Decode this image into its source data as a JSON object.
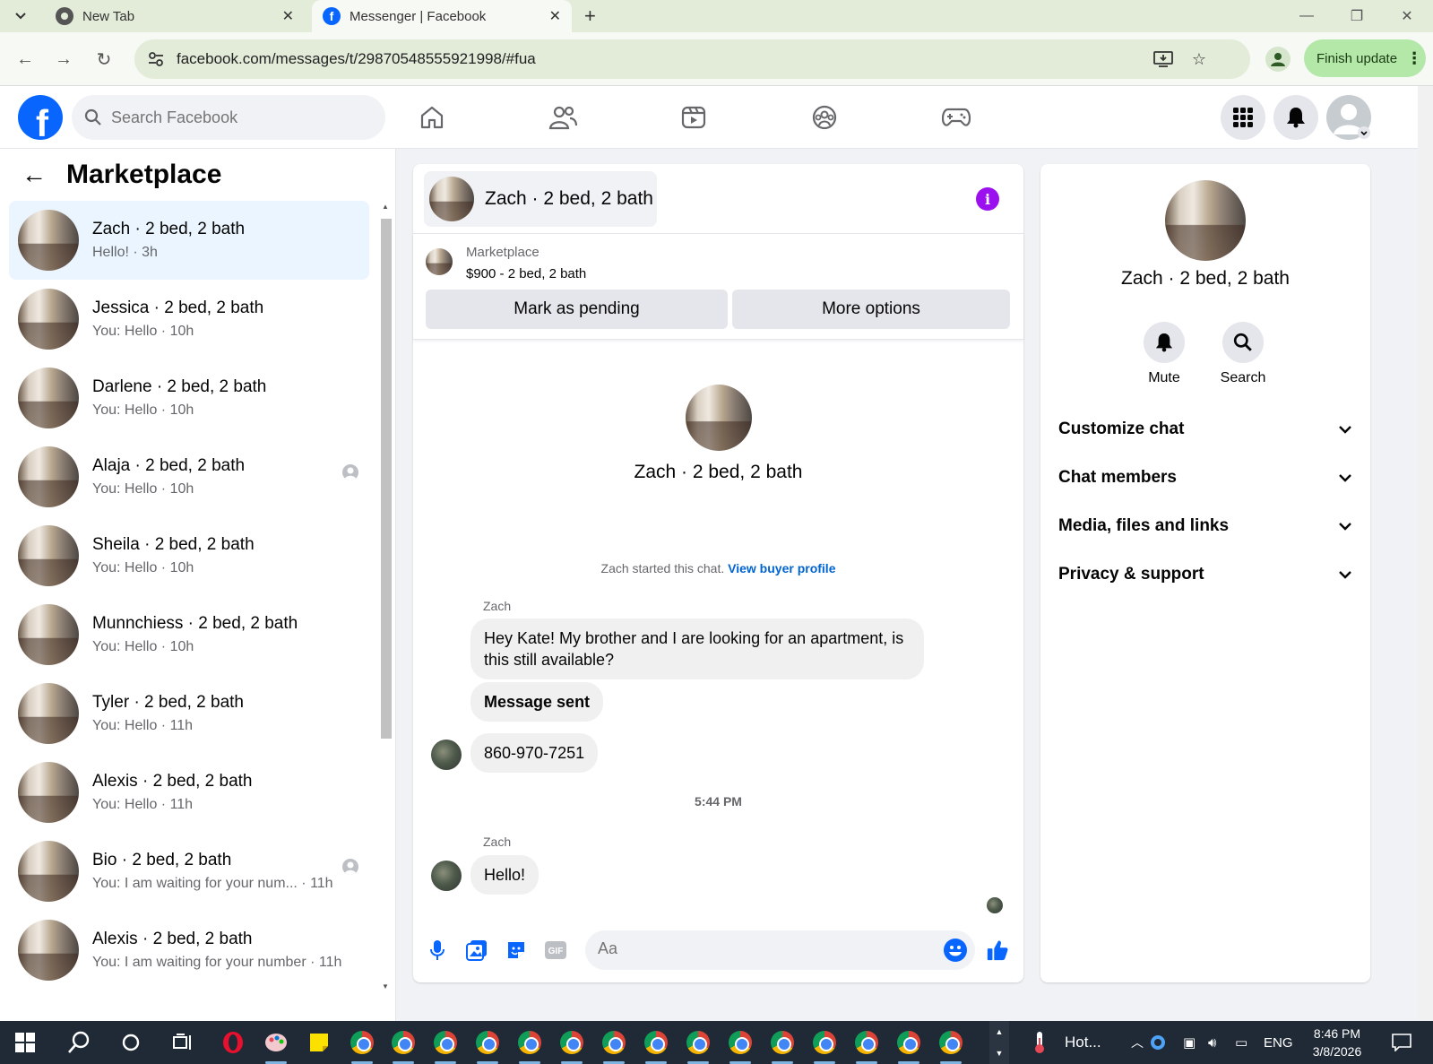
{
  "browser": {
    "tabs": [
      {
        "title": "New Tab",
        "active": false
      },
      {
        "title": "Messenger | Facebook",
        "active": true
      }
    ],
    "url": "facebook.com/messages/t/29870548555921998/#fua",
    "finish_update_label": "Finish update"
  },
  "fb_header": {
    "logo_letter": "f",
    "search_placeholder": "Search Facebook",
    "nav_icons": [
      "home-icon",
      "friends-icon",
      "video-icon",
      "groups-icon",
      "gaming-icon"
    ],
    "colors": {
      "brand": "#0866ff",
      "selected_bg": "#ebf5ff",
      "link": "#0064d1",
      "info": "#9b10ef"
    }
  },
  "sidebar": {
    "title": "Marketplace",
    "conversations": [
      {
        "name": "Zach · 2 bed, 2 bath",
        "subtitle": "Hello! · 3h",
        "selected": true,
        "seen_avatar": false
      },
      {
        "name": "Jessica · 2 bed, 2 bath",
        "subtitle": "You: Hello · 10h",
        "selected": false,
        "seen_avatar": false
      },
      {
        "name": "Darlene · 2 bed, 2 bath",
        "subtitle": "You: Hello · 10h",
        "selected": false,
        "seen_avatar": false
      },
      {
        "name": "Alaja · 2 bed, 2 bath",
        "subtitle": "You: Hello · 10h",
        "selected": false,
        "seen_avatar": true
      },
      {
        "name": "Sheila · 2 bed, 2 bath",
        "subtitle": "You: Hello · 10h",
        "selected": false,
        "seen_avatar": false
      },
      {
        "name": "Munnchiess · 2 bed, 2 bath",
        "subtitle": "You: Hello · 10h",
        "selected": false,
        "seen_avatar": false
      },
      {
        "name": "Tyler · 2 bed, 2 bath",
        "subtitle": "You: Hello · 11h",
        "selected": false,
        "seen_avatar": false
      },
      {
        "name": "Alexis · 2 bed, 2 bath",
        "subtitle": "You: Hello · 11h",
        "selected": false,
        "seen_avatar": false
      },
      {
        "name": "Bio · 2 bed, 2 bath",
        "subtitle": "You: I am waiting for your num... · 11h",
        "selected": false,
        "seen_avatar": true
      },
      {
        "name": "Alexis · 2 bed, 2 bath",
        "subtitle": "You: I am waiting for your number · 11h",
        "selected": false,
        "seen_avatar": false
      }
    ]
  },
  "chat": {
    "title": "Zach · 2 bed, 2 bath",
    "listing": {
      "label": "Marketplace",
      "price_line": "$900 - 2 bed, 2 bath",
      "mark_pending": "Mark as pending",
      "more_options": "More options"
    },
    "profile_name": "Zach · 2 bed, 2 bath",
    "started_text": "Zach started this chat.",
    "view_profile": "View buyer profile",
    "sender_1": "Zach",
    "message_1": "Hey Kate! My brother and I are looking for an apartment, is this still available?",
    "message_2": "Message sent",
    "message_3": "860-970-7251",
    "timestamp": "5:44 PM",
    "sender_2": "Zach",
    "message_4": "Hello!",
    "composer_placeholder": "Aa"
  },
  "details": {
    "name": "Zach · 2 bed, 2 bath",
    "mute": "Mute",
    "search": "Search",
    "sections": [
      "Customize chat",
      "Chat members",
      "Media, files and links",
      "Privacy & support"
    ]
  },
  "taskbar": {
    "weather": "Hot...",
    "lang": "ENG",
    "time": "8:46 PM",
    "date": "3/8/2026"
  }
}
